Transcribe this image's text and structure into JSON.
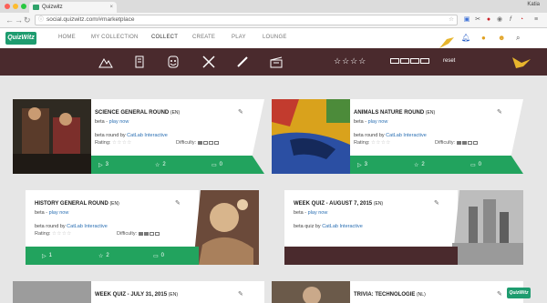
{
  "browser": {
    "tab_title": "Quizwitz",
    "user_name": "Katia",
    "url": "social.quizwitz.com/#marketplace"
  },
  "app": {
    "logo": "QuizWitz",
    "nav": [
      "HOME",
      "MY COLLECTION",
      "COLLECT",
      "CREATE",
      "PLAY",
      "LOUNGE"
    ],
    "active_nav": "COLLECT"
  },
  "filters": {
    "categories": [
      "mountain-icon",
      "scroll-icon",
      "theater-masks-icon",
      "tools-icon",
      "pencil-icon",
      "clapperboard-icon"
    ],
    "rating_stars": "☆☆☆☆",
    "reset_label": "reset"
  },
  "cards": [
    {
      "title": "SCIENCE GENERAL ROUND",
      "lang": "(EN)",
      "stage": "beta",
      "play": "play now",
      "desc_prefix": "beta round by",
      "author": "CatLab Interactive",
      "rating_label": "Rating:",
      "rating": "☆☆☆☆",
      "difficulty_label": "Difficulty:",
      "difficulty": 1,
      "plays": "3",
      "likes": "2",
      "comments": "0"
    },
    {
      "title": "ANIMALS NATURE ROUND",
      "lang": "(EN)",
      "stage": "beta",
      "play": "play now",
      "desc_prefix": "beta round by",
      "author": "CatLab Interactive",
      "rating_label": "Rating:",
      "rating": "☆☆☆☆",
      "difficulty_label": "Difficulty:",
      "difficulty": 2,
      "plays": "3",
      "likes": "2",
      "comments": "0"
    },
    {
      "title": "HISTORY GENERAL ROUND",
      "lang": "(EN)",
      "stage": "beta",
      "play": "play now",
      "desc_prefix": "beta round by",
      "author": "CatLab Interactive",
      "rating_label": "Rating:",
      "rating": "☆☆☆☆",
      "difficulty_label": "Difficulty:",
      "difficulty": 2,
      "plays": "1",
      "likes": "2",
      "comments": "0"
    },
    {
      "title": "WEEK QUIZ - AUGUST 7, 2015",
      "lang": "(EN)",
      "stage": "beta",
      "play": "play now",
      "desc_prefix": "beta quiz by",
      "author": "CatLab Interactive",
      "rating_label": "Rating:",
      "rating": "☆☆☆☆",
      "difficulty_label": "Difficulty:",
      "difficulty": 2,
      "plays": "",
      "likes": "",
      "comments": ""
    },
    {
      "title": "WEEK QUIZ - JULY 31, 2015",
      "lang": "(EN)"
    },
    {
      "title": "TRIVIA: TECHNOLOGIE",
      "lang": "(NL)"
    }
  ],
  "colors": {
    "green": "#22a35e",
    "maroon": "#4a2a2d",
    "link": "#2a6fb3"
  }
}
